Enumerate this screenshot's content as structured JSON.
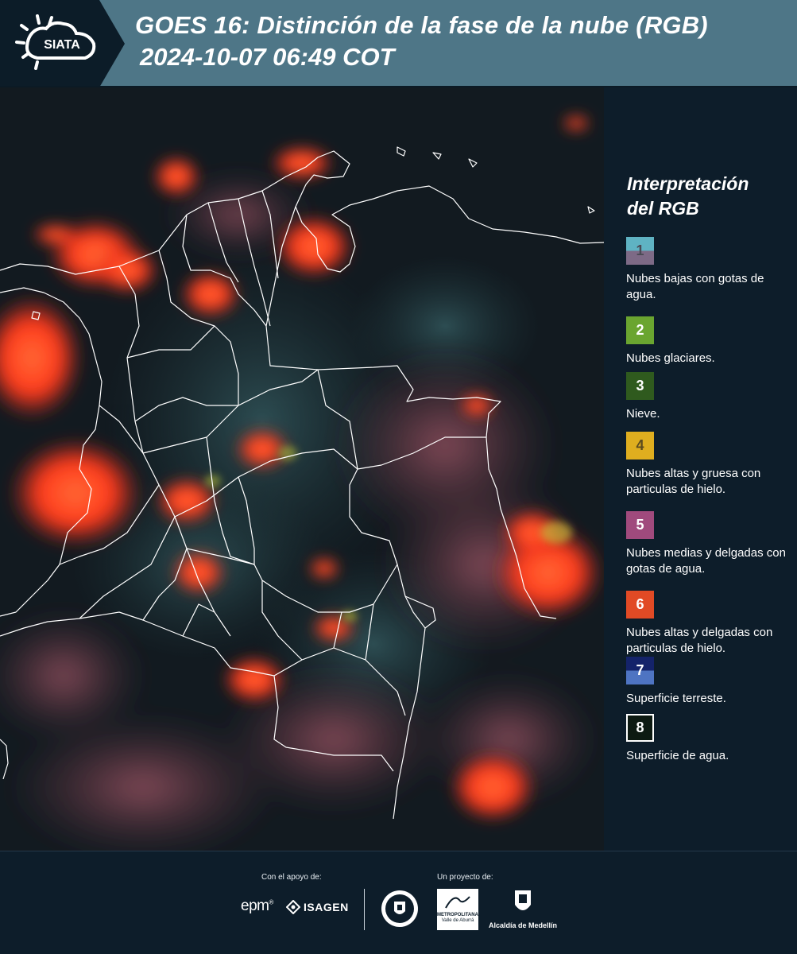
{
  "header": {
    "logo_text": "SIATA",
    "title_line1": "GOES 16: Distinción de la fase de la nube (RGB)",
    "title_line2": "2024-10-07 06:49 COT"
  },
  "legend": {
    "title_line1": "Interpretación",
    "title_line2": "del RGB",
    "items": [
      {
        "number": "1",
        "label": "Nubes bajas con gotas de agua.",
        "top_color": "#5fb3c3",
        "bottom_color": "#7d6a86",
        "text_color": "#4a4a55"
      },
      {
        "number": "2",
        "label": "Nubes glaciares.",
        "top_color": "#6aa530",
        "bottom_color": "#6aa530",
        "text_color": "#ffffff"
      },
      {
        "number": "3",
        "label": "Nieve.",
        "top_color": "#2f5a1e",
        "bottom_color": "#2f5a1e",
        "text_color": "#ffffff"
      },
      {
        "number": "4",
        "label": "Nubes altas y gruesa con particulas de hielo.",
        "top_color": "#dfae1f",
        "bottom_color": "#dfae1f",
        "text_color": "#5b4a1f"
      },
      {
        "number": "5",
        "label": "Nubes medias y delgadas con gotas de agua.",
        "top_color": "#a04a7d",
        "bottom_color": "#a04a7d",
        "text_color": "#ffffff"
      },
      {
        "number": "6",
        "label": "Nubes altas y delgadas con particulas de hielo.",
        "top_color": "#e14a25",
        "bottom_color": "#e14a25",
        "text_color": "#ffffff"
      },
      {
        "number": "7",
        "label": "Superficie terreste.",
        "top_color": "#14236a",
        "bottom_color": "#4e74c2",
        "text_color": "#ffffff"
      },
      {
        "number": "8",
        "label": "Superficie de agua.",
        "top_color": "#0d1a12",
        "bottom_color": "#0d1a12",
        "text_color": "#ffffff"
      }
    ]
  },
  "footer": {
    "support_caption": "Con el apoyo de:",
    "project_caption": "Un proyecto de:",
    "sponsors": {
      "epm": "epm",
      "isagen": "ISAGEN",
      "area_top": "METROPOLITANA",
      "area_bottom": "Valle de Aburrá",
      "alcaldia": "Alcaldía de Medellín"
    }
  },
  "colors": {
    "header_bg": "#4e7687",
    "panel_bg": "#0d1d2a",
    "cloud_red": "#ff4a22",
    "cloud_pink": "#a05a6a"
  }
}
